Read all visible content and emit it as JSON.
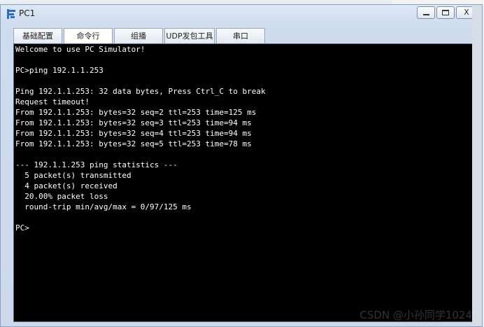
{
  "window": {
    "title": "PC1"
  },
  "tabs": [
    {
      "label": "基础配置",
      "active": false
    },
    {
      "label": "命令行",
      "active": true
    },
    {
      "label": "组播",
      "active": false
    },
    {
      "label": "UDP发包工具",
      "active": false
    },
    {
      "label": "串口",
      "active": false
    }
  ],
  "terminal": {
    "lines": [
      "Welcome to use PC Simulator!",
      "",
      "PC>ping 192.1.1.253",
      "",
      "Ping 192.1.1.253: 32 data bytes, Press Ctrl_C to break",
      "Request timeout!",
      "From 192.1.1.253: bytes=32 seq=2 ttl=253 time=125 ms",
      "From 192.1.1.253: bytes=32 seq=3 ttl=253 time=94 ms",
      "From 192.1.1.253: bytes=32 seq=4 ttl=253 time=94 ms",
      "From 192.1.1.253: bytes=32 seq=5 ttl=253 time=78 ms",
      "",
      "--- 192.1.1.253 ping statistics ---",
      "  5 packet(s) transmitted",
      "  4 packet(s) received",
      "  20.00% packet loss",
      "  round-trip min/avg/max = 0/97/125 ms",
      "",
      "PC>"
    ]
  },
  "watermark": "CSDN @小孙同学1024",
  "colors": {
    "terminal_bg": "#000000",
    "terminal_fg": "#ffffff",
    "window_chrome": "#cfdcee"
  }
}
